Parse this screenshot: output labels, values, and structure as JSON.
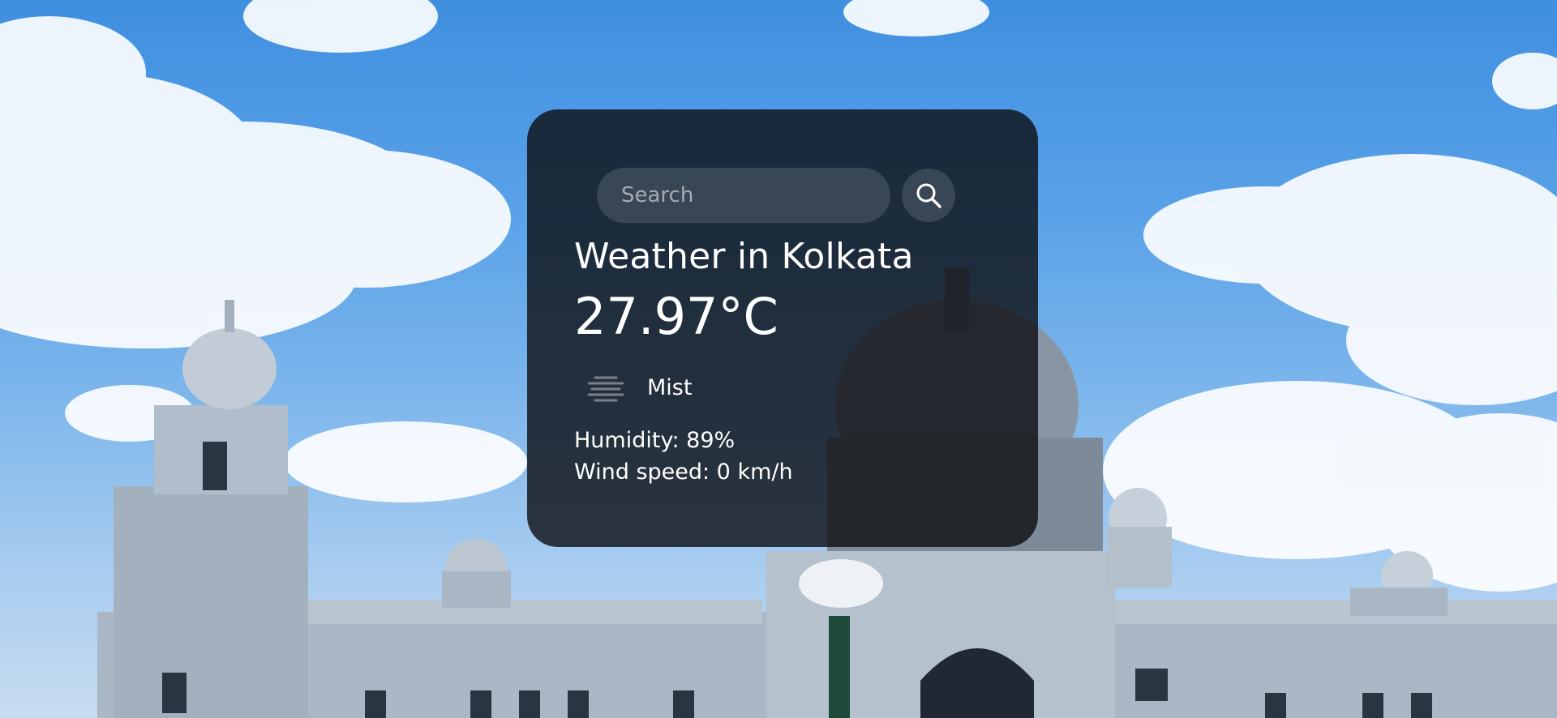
{
  "search": {
    "placeholder": "Search",
    "value": ""
  },
  "weather": {
    "title": "Weather in Kolkata",
    "temperature": "27.97°C",
    "condition": "Mist",
    "condition_icon": "mist-icon",
    "humidity": "Humidity: 89%",
    "wind": "Wind speed: 0 km/h"
  },
  "icons": {
    "search_button": "search-icon"
  },
  "colors": {
    "card_background": "#0c0e12",
    "text": "#ffffff",
    "sky": "#5aa2e8"
  }
}
